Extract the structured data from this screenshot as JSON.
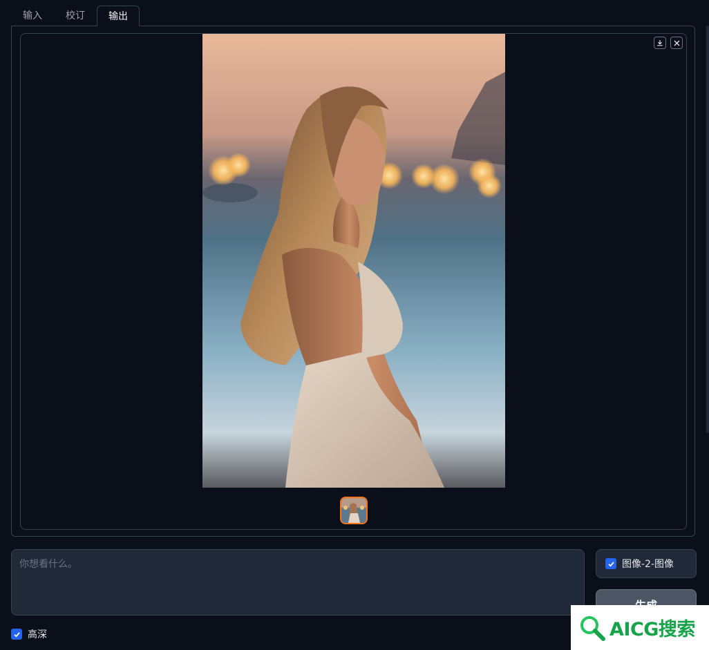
{
  "tabs": [
    {
      "label": "输入"
    },
    {
      "label": "校订"
    },
    {
      "label": "输出",
      "active": true
    }
  ],
  "gallery": {
    "main_image": "portrait-woman-beach-dress",
    "thumbnail": "portrait-woman-beach-thumb",
    "download_icon": "download-icon",
    "close_icon": "close-icon"
  },
  "prompt": {
    "placeholder": "你想看什么。",
    "value": ""
  },
  "mode": {
    "label": "图像-2-图像",
    "checked": true
  },
  "generate": {
    "label": "生成"
  },
  "hd": {
    "label": "高深",
    "checked": true
  },
  "watermark": {
    "text": "AICG搜索"
  },
  "colors": {
    "background": "#0b0f19",
    "border": "#374151",
    "accent": "#2563eb",
    "thumb_border": "#f97316",
    "watermark": "#16a34a"
  }
}
